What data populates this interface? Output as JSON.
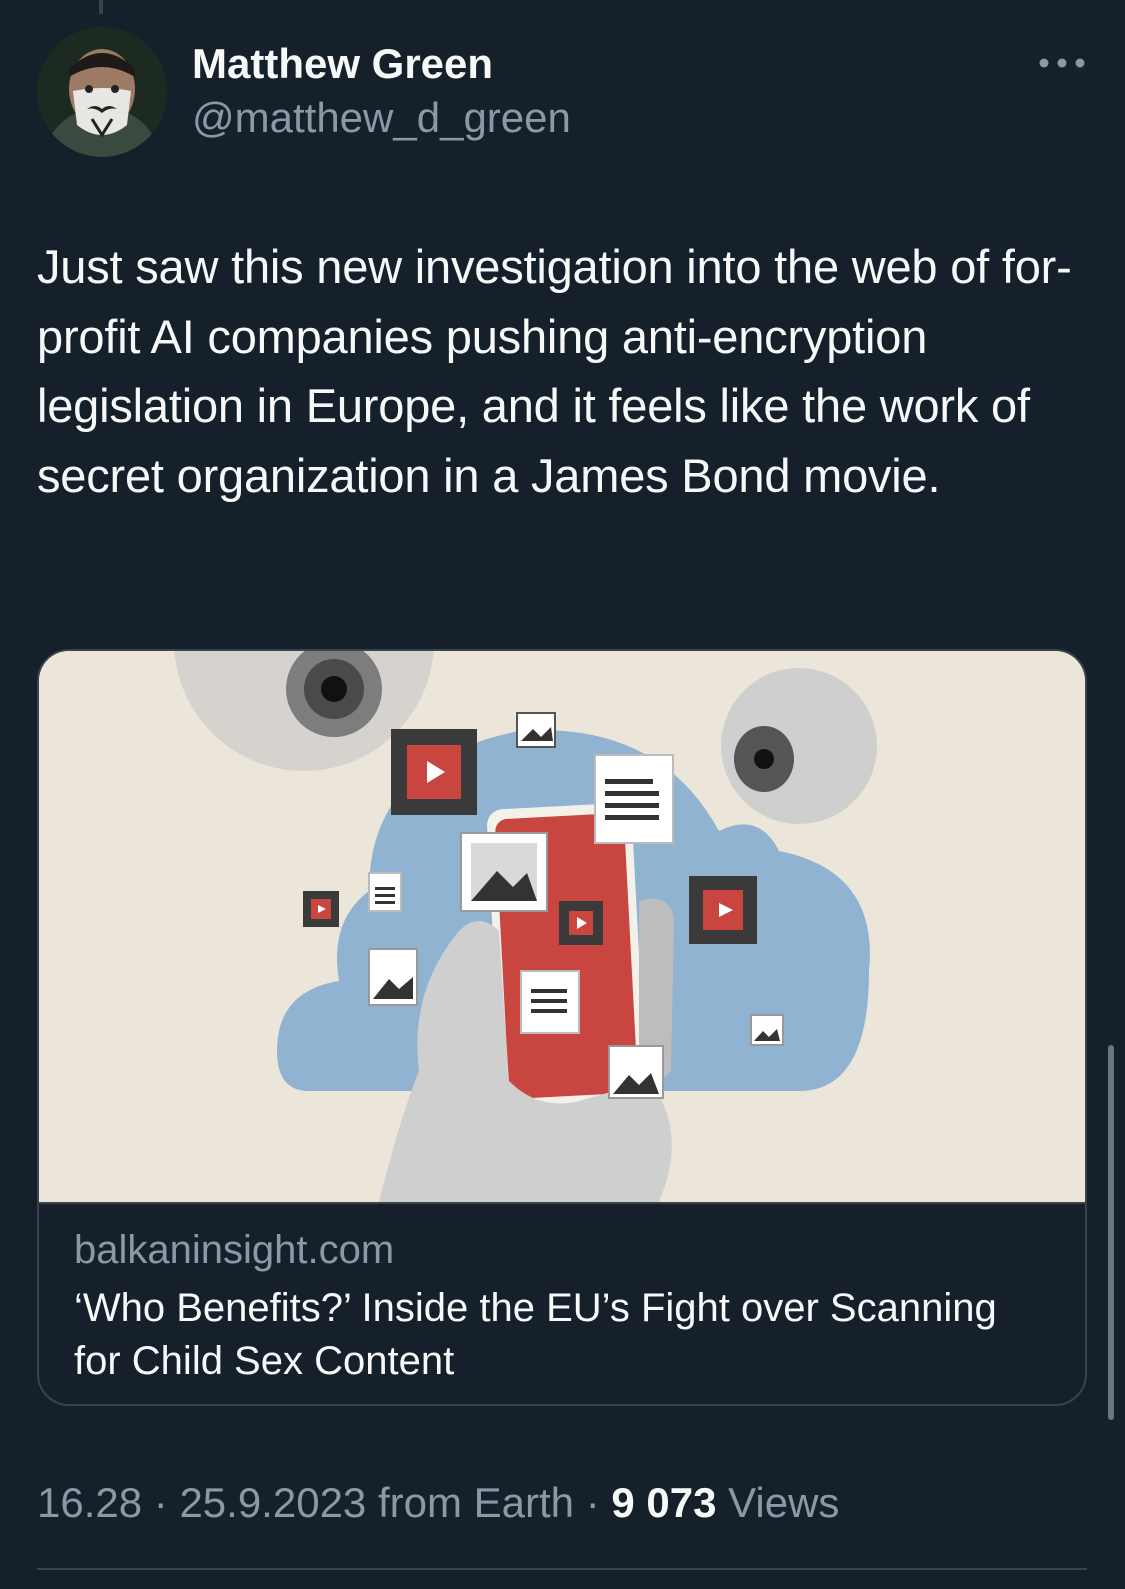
{
  "tweet": {
    "author": {
      "name": "Matthew Green",
      "handle": "@matthew_d_green",
      "avatar_icon": "avatar-masked-person-icon"
    },
    "more_icon": "more-options-icon",
    "text": "Just saw this new investigation into the web of for-profit AI companies pushing anti-encryption legislation in Europe, and it feels like the work of secret organization in a James Bond movie.",
    "link_card": {
      "image_icon": "illustration-hand-phone-cloud-eyes",
      "domain": "balkaninsight.com",
      "title": "‘Who Benefits?’ Inside the EU’s Fight over Scanning for Child Sex Content"
    },
    "meta": {
      "time": "16.28",
      "separator": " · ",
      "date": "25.9.2023",
      "source": " from Earth",
      "views_count": "9 073",
      "views_label": " Views"
    }
  },
  "colors": {
    "background": "#15202b",
    "primary_text": "#f7f9f9",
    "secondary_text": "#8b98a5",
    "border": "#38444d"
  }
}
